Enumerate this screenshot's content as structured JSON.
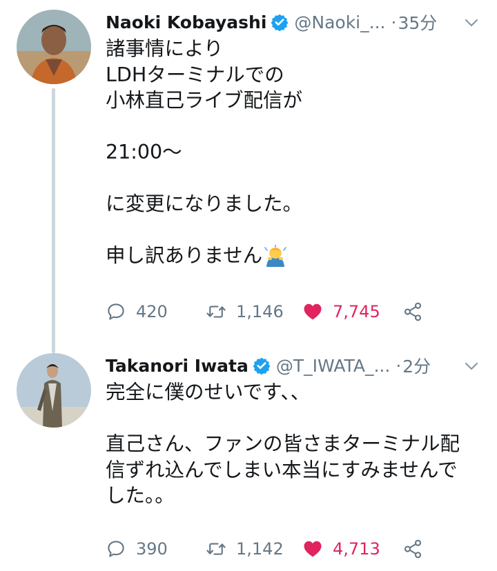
{
  "tweets": [
    {
      "author_name": "Naoki Kobayashi",
      "handle": "@Naoki_...",
      "separator": "·",
      "time": "35分",
      "lines": [
        "諸事情により",
        "LDHターミナルでの",
        "小林直己ライブ配信が",
        "",
        "21:00〜",
        "",
        "に変更になりました。",
        "",
        "申し訳ありません"
      ],
      "emoji": "person-bowing-emoji",
      "replies": "420",
      "retweets": "1,146",
      "likes": "7,745",
      "liked": true
    },
    {
      "author_name": "Takanori Iwata",
      "handle": "@T_IWATA_...",
      "separator": "·",
      "time": "2分",
      "lines": [
        "完全に僕のせいです、、",
        "",
        "直己さん、ファンの皆さまターミナル配",
        "信ずれ込んでしまい本当にすみませんで",
        "した。。"
      ],
      "replies": "390",
      "retweets": "1,142",
      "likes": "4,713",
      "liked": true
    }
  ],
  "colors": {
    "text": "#14171a",
    "secondary": "#657786",
    "verified": "#1da1f2",
    "like": "#e0245e",
    "thread_line": "#ccd6dd"
  },
  "icons": [
    "reply-icon",
    "retweet-icon",
    "heart-icon",
    "share-icon",
    "verified-badge-icon",
    "chevron-down-icon"
  ]
}
